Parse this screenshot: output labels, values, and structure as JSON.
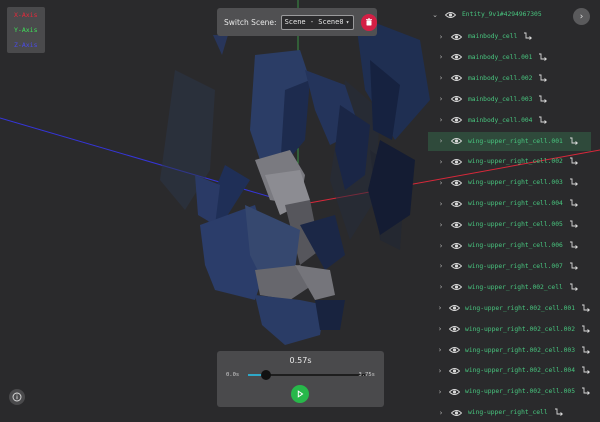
{
  "axes": {
    "x_label": "X-Axis",
    "y_label": "Y-Axis",
    "z_label": "Z-Axis"
  },
  "scene": {
    "label": "Switch Scene:",
    "selected": "Scene - Scene0"
  },
  "hierarchy": {
    "root": "Entity_9v1#4294967305",
    "items": [
      "mainbody_cell",
      "mainbody_cell.001",
      "mainbody_cell.002",
      "mainbody_cell.003",
      "mainbody_cell.004",
      "wing-upper_right_cell.001",
      "wing-upper_right_cell.002",
      "wing-upper_right_cell.003",
      "wing-upper_right_cell.004",
      "wing-upper_right_cell.005",
      "wing-upper_right_cell.006",
      "wing-upper_right_cell.007",
      "wing-upper_right.002_cell",
      "wing-upper_right.002_cell.001",
      "wing-upper_right.002_cell.002",
      "wing-upper_right.002_cell.003",
      "wing-upper_right.002_cell.004",
      "wing-upper_right.002_cell.005",
      "wing-upper_right_cell"
    ],
    "selected_index": 5
  },
  "timeline": {
    "current": "0.57s",
    "start": "0.0s",
    "end": "3.75s",
    "progress": 0.152
  },
  "colors": {
    "x_axis": "#e8283a",
    "y_axis": "#3fe05a",
    "z_axis": "#3a3ae8",
    "accent_green": "#48c67f",
    "delete_red": "#d41f45",
    "play_green": "#27b84a"
  }
}
